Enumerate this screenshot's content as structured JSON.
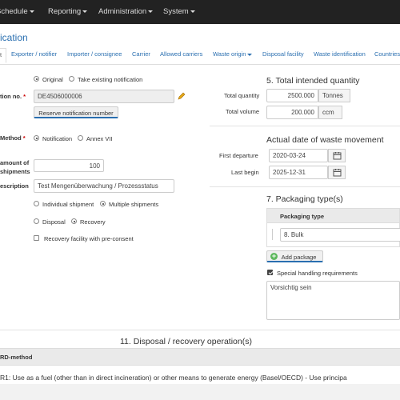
{
  "nav": {
    "schedule": "Schedule",
    "reporting": "Reporting",
    "administration": "Administration",
    "system": "System"
  },
  "page_title": "ication",
  "tabs": [
    "t",
    "Exporter / notifier",
    "Importer / consignee",
    "Carrier",
    "Allowed carriers",
    "Waste origin",
    "Disposal facility",
    "Waste identification",
    "Countries"
  ],
  "form": {
    "type_original": "Original",
    "type_take_existing": "Take existing notification",
    "notification_no_label": "tion no.",
    "notification_no_value": "DE4506000006",
    "reserve_button": "Reserve notification number",
    "method_label": "Method",
    "method_notification": "Notification",
    "method_annex": "Annex VII",
    "amount_label_1": "amount of",
    "amount_label_2": "shipments",
    "amount_value": "100",
    "description_label": "escription",
    "description_value": "Test Mengenüberwachung / Prozessstatus",
    "individual_shipment": "Individual shipment",
    "multiple_shipments": "Multiple shipments",
    "disposal": "Disposal",
    "recovery": "Recovery",
    "preconsent": "Recovery facility with pre-consent"
  },
  "quantity": {
    "heading": "5. Total intended quantity",
    "total_quantity_label": "Total quantity",
    "total_quantity_value": "2500.000",
    "total_quantity_unit": "Tonnes",
    "total_volume_label": "Total volume",
    "total_volume_value": "200.000",
    "total_volume_unit": "ccm"
  },
  "movement": {
    "heading": "Actual date of waste movement",
    "first_departure_label": "First departure",
    "first_departure_value": "2020-03-24",
    "last_begin_label": "Last begin",
    "last_begin_value": "2025-12-31"
  },
  "packaging": {
    "heading": "7. Packaging type(s)",
    "column_header": "Packaging type",
    "row_value": "8. Bulk",
    "add_button": "Add package",
    "special_handling": "Special handling requirements",
    "special_text": "Vorsichtig sein"
  },
  "operations": {
    "heading": "11. Disposal / recovery operation(s)",
    "column_header": "RD-method",
    "row_text": "R1: Use as a fuel (other than in direct incineration) or other means to generate energy (Basel/OECD) - Use principa"
  },
  "colors": {
    "navbar": "#222222",
    "link": "#2a6fb0",
    "required": "#cc0000",
    "add_icon": "#5cb85c"
  }
}
